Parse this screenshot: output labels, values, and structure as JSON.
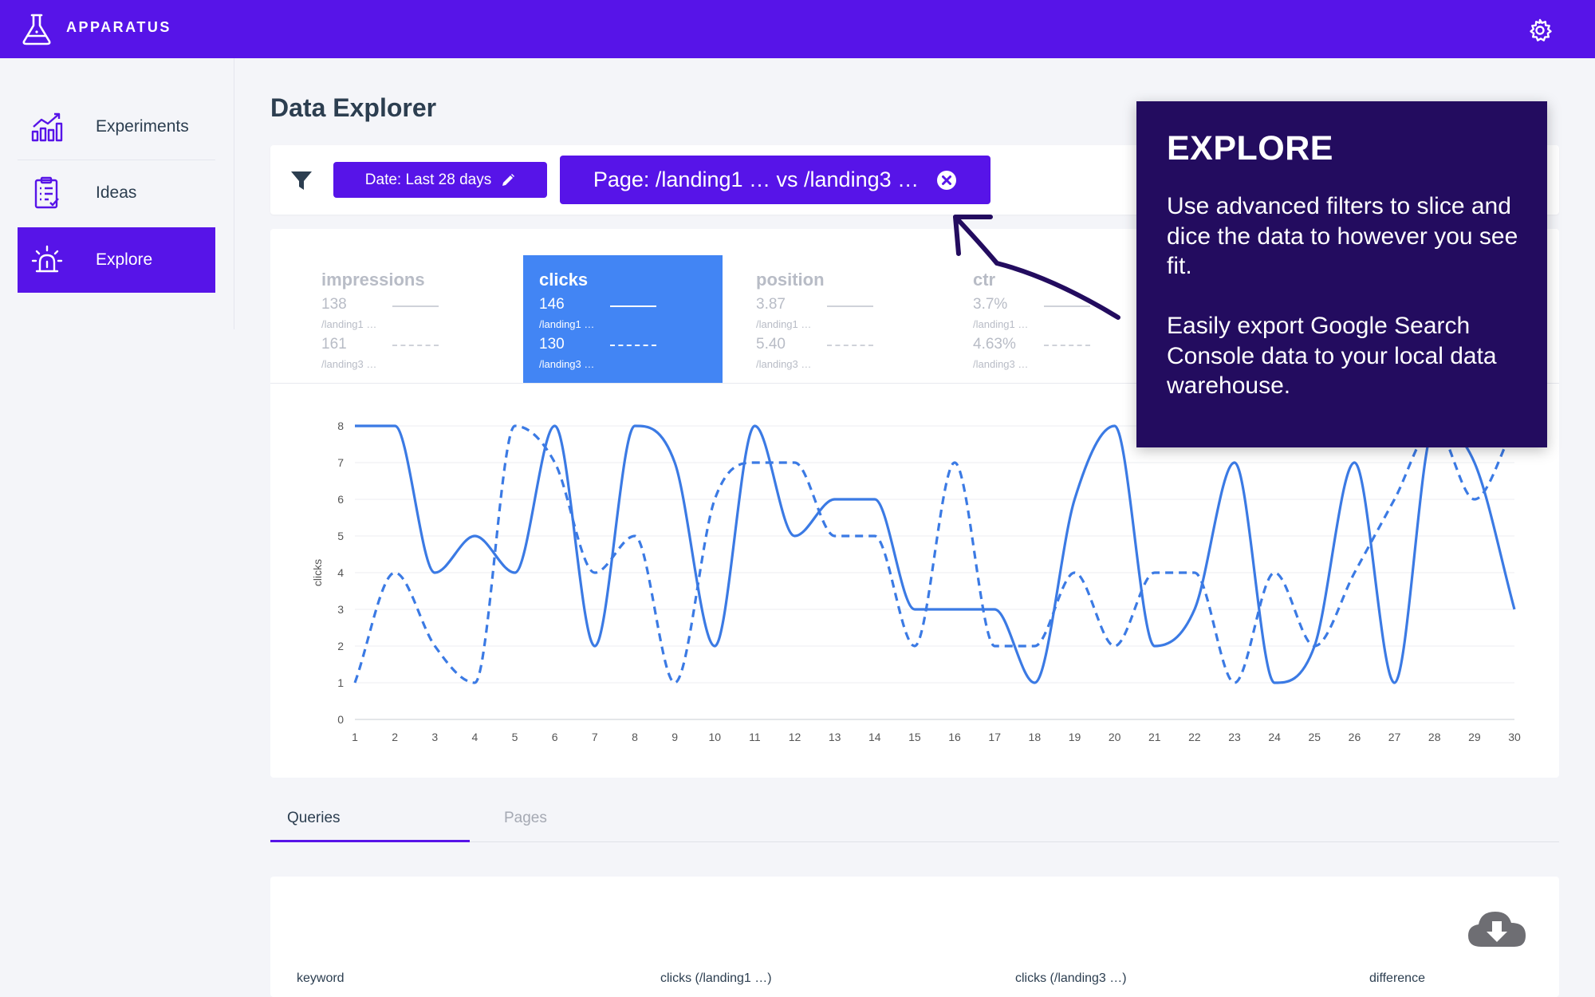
{
  "brand": {
    "name": "APPARATUS"
  },
  "sidebar": {
    "items": [
      {
        "label": "Experiments",
        "icon": "chart-growth-icon",
        "active": false
      },
      {
        "label": "Ideas",
        "icon": "clipboard-list-icon",
        "active": false
      },
      {
        "label": "Explore",
        "icon": "alarm-light-icon",
        "active": true
      }
    ]
  },
  "page": {
    "title": "Data Explorer"
  },
  "filters": {
    "date_chip": "Date: Last 28 days",
    "page_chip": "Page: /landing1 … vs /landing3 …"
  },
  "metrics": [
    {
      "title": "impressions",
      "v1": "138",
      "s1": "/landing1 …",
      "v2": "161",
      "s2": "/landing3 …",
      "active": false
    },
    {
      "title": "clicks",
      "v1": "146",
      "s1": "/landing1 …",
      "v2": "130",
      "s2": "/landing3 …",
      "active": true
    },
    {
      "title": "position",
      "v1": "3.87",
      "s1": "/landing1 …",
      "v2": "5.40",
      "s2": "/landing3 …",
      "active": false
    },
    {
      "title": "ctr",
      "v1": "3.7%",
      "s1": "/landing1 …",
      "v2": "4.63%",
      "s2": "/landing3 …",
      "active": false
    }
  ],
  "chart_data": {
    "type": "line",
    "ylabel": "clicks",
    "xlabel": "",
    "ylim": [
      0,
      8
    ],
    "x": [
      1,
      2,
      3,
      4,
      5,
      6,
      7,
      8,
      9,
      10,
      11,
      12,
      13,
      14,
      15,
      16,
      17,
      18,
      19,
      20,
      21,
      22,
      23,
      24,
      25,
      26,
      27,
      28,
      29,
      30
    ],
    "yticks": [
      0,
      1,
      2,
      3,
      4,
      5,
      6,
      7,
      8
    ],
    "grid": true,
    "series": [
      {
        "style": "solid",
        "values": [
          8,
          8,
          4,
          5,
          4,
          8,
          2,
          8,
          7,
          2,
          8,
          5,
          6,
          6,
          3,
          3,
          3,
          1,
          6,
          8,
          2,
          3,
          7,
          1,
          2,
          7,
          1,
          8,
          7,
          3
        ]
      },
      {
        "style": "dashed",
        "values": [
          1,
          4,
          2,
          1,
          8,
          7,
          4,
          5,
          1,
          6,
          7,
          7,
          5,
          5,
          2,
          7,
          2,
          2,
          4,
          2,
          4,
          4,
          1,
          4,
          2,
          4,
          6,
          8,
          6,
          8
        ]
      }
    ],
    "color": "#3b7ae4"
  },
  "tabs": [
    {
      "label": "Queries",
      "active": true
    },
    {
      "label": "Pages",
      "active": false
    }
  ],
  "table": {
    "headers": [
      "keyword",
      "clicks (/landing1 …)",
      "clicks (/landing3 …)",
      "difference"
    ]
  },
  "tour": {
    "title": "EXPLORE",
    "p1": "Use advanced filters to slice and dice the data to however you see fit.",
    "p2": "Easily export Google Search Console data to your local data warehouse."
  },
  "colors": {
    "primary": "#5714e8",
    "active_metric": "#4285f4",
    "tour_bg": "#230c5f"
  }
}
